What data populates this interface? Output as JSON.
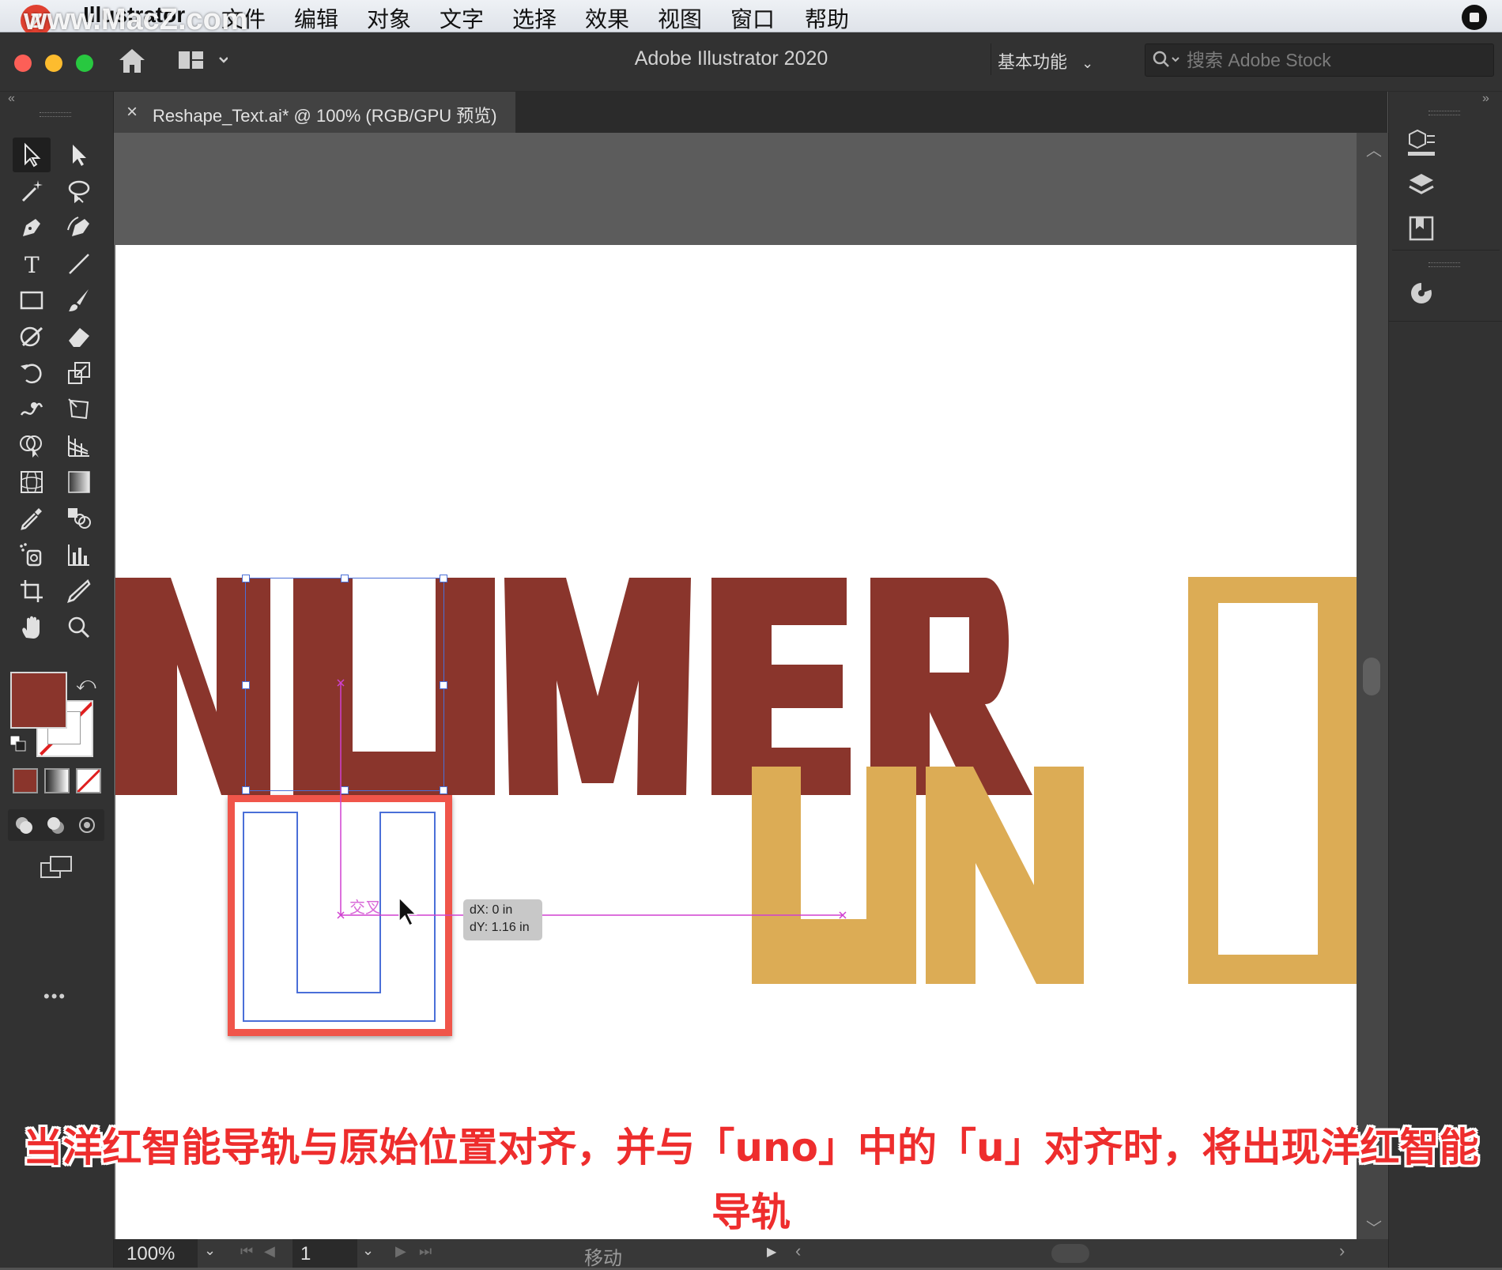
{
  "menubar": {
    "app_name": "Illustrator",
    "items": [
      "文件",
      "编辑",
      "对象",
      "文字",
      "选择",
      "效果",
      "视图",
      "窗口",
      "帮助"
    ],
    "watermark": "www.MacZ.com",
    "watermark_logo": "Z"
  },
  "titlebar": {
    "app_title": "Adobe Illustrator 2020",
    "workspace": "基本功能",
    "search_placeholder": "搜索 Adobe Stock"
  },
  "document_tab": {
    "label": "Reshape_Text.ai* @ 100% (RGB/GPU 预览)",
    "close": "×"
  },
  "canvas": {
    "word_top": "NUMER",
    "word_bottom": "UNO",
    "smart_guide_label": "交叉",
    "tooltip_dx": "dX: 0 in",
    "tooltip_dy": "dY: 1.16 in",
    "colors": {
      "top_text": "#8a352c",
      "bottom_text": "#dcac55",
      "smart_guide": "#d040d0",
      "selection": "#4a6fd8",
      "highlight_box": "#f0554a"
    }
  },
  "toolbar": {
    "more_label": "•••",
    "fill_color": "#8a352c"
  },
  "statusbar": {
    "zoom": "100%",
    "artboard_num": "1",
    "status_text": "移动"
  },
  "caption": {
    "line1": "当洋红智能导轨与原始位置对齐，并与「uno」中的「u」对齐时，将出现洋红智能",
    "line2": "导轨"
  }
}
